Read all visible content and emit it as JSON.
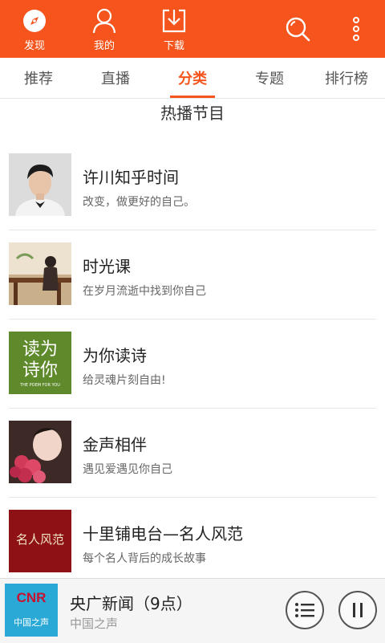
{
  "topbar": {
    "discover_label": "发现",
    "mine_label": "我的",
    "download_label": "下载",
    "accent": "#f5541c"
  },
  "tabs": [
    {
      "label": "推荐",
      "active": false
    },
    {
      "label": "直播",
      "active": false
    },
    {
      "label": "分类",
      "active": true
    },
    {
      "label": "专题",
      "active": false
    },
    {
      "label": "排行榜",
      "active": false
    }
  ],
  "section": {
    "title": "热播节目"
  },
  "programs": [
    {
      "title": "许川知乎时间",
      "subtitle": "改变，做更好的自己。"
    },
    {
      "title": "时光课",
      "subtitle": "在岁月流逝中找到你自己"
    },
    {
      "title": "为你读诗",
      "subtitle": "给灵魂片刻自由!"
    },
    {
      "title": "金声相伴",
      "subtitle": "遇见爱遇见你自己"
    },
    {
      "title": "十里铺电台—名人风范",
      "subtitle": "每个名人背后的成长故事"
    }
  ],
  "thumb_text": {
    "poem_line1": "读为",
    "poem_line2": "诗你",
    "poem_caption": "THE POEM FOR YOU",
    "celebrity": "名人风范"
  },
  "player": {
    "title": "央广新闻（9点）",
    "subtitle": "中国之声",
    "art_logo": "CNR",
    "art_caption": "中国之声"
  }
}
